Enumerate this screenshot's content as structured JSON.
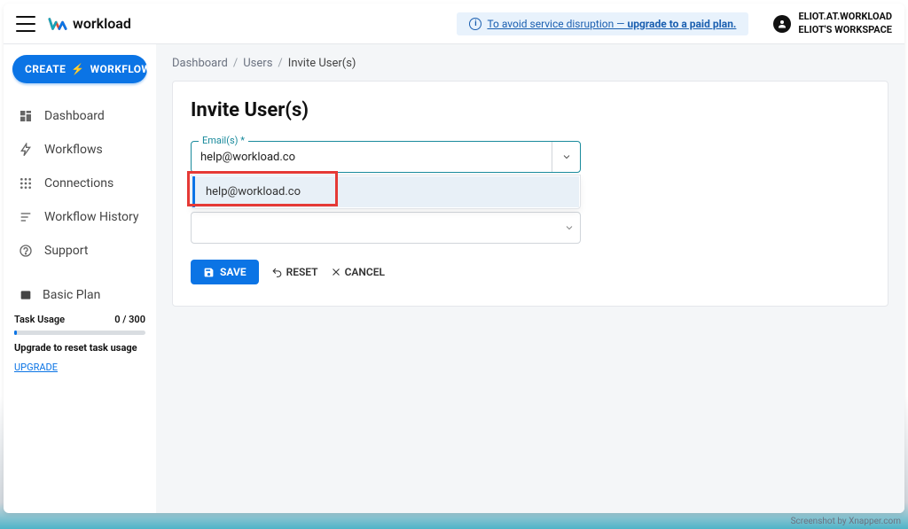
{
  "header": {
    "logo_text": "workload",
    "banner_pre": "To avoid service disruption — ",
    "banner_bold": "upgrade to a paid plan.",
    "user_line1": "ELIOT.AT.WORKLOAD",
    "user_line2": "ELIOT'S WORKSPACE"
  },
  "sidebar": {
    "create_left": "CREATE",
    "create_right": "WORKFLOW",
    "items": [
      {
        "label": "Dashboard"
      },
      {
        "label": "Workflows"
      },
      {
        "label": "Connections"
      },
      {
        "label": "Workflow History"
      },
      {
        "label": "Support"
      }
    ],
    "plan_label": "Basic Plan",
    "usage_label": "Task Usage",
    "usage_value": "0 / 300",
    "usage_note": "Upgrade to reset task usage",
    "upgrade_link": "UPGRADE"
  },
  "breadcrumbs": {
    "c1": "Dashboard",
    "c2": "Users",
    "c3": "Invite User(s)"
  },
  "main": {
    "title": "Invite User(s)",
    "email_label": "Email(s) *",
    "email_value": "help@workload.co",
    "dropdown_option": "help@workload.co",
    "save": "SAVE",
    "reset": "RESET",
    "cancel": "CANCEL"
  },
  "footer": {
    "credit": "Screenshot by Xnapper.com"
  }
}
